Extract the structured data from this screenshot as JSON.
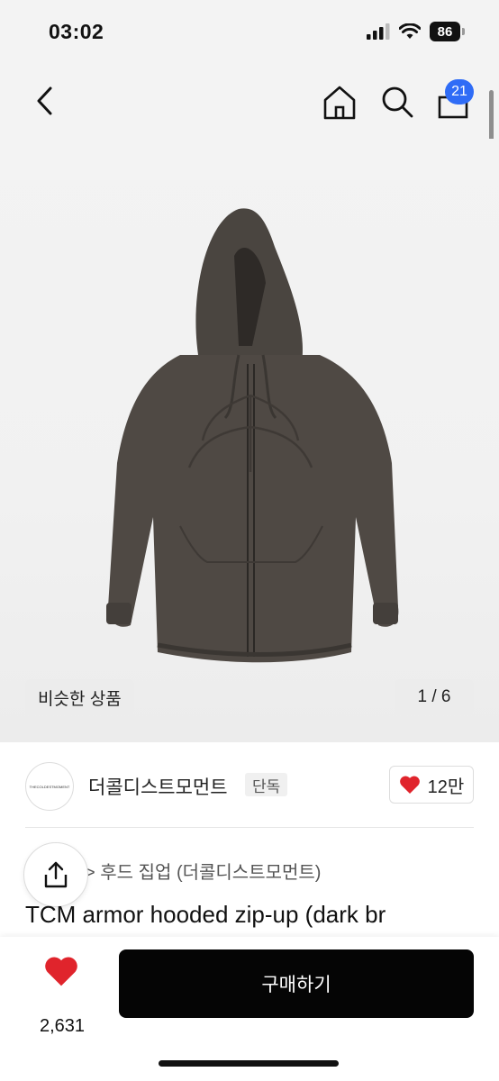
{
  "status_bar": {
    "time": "03:02",
    "battery": "86",
    "icons": [
      "signal-icon",
      "wifi-icon",
      "battery-icon"
    ]
  },
  "nav": {
    "icons": [
      "back-icon",
      "home-icon",
      "search-icon",
      "cart-icon"
    ],
    "cart_badge": "21"
  },
  "gallery": {
    "similar_label": "비슷한 상품",
    "page_counter": "1 / 6"
  },
  "brand": {
    "name": "더콜디스트모먼트",
    "tag": "단독",
    "logo_text": "THECOLDESTMOMENT",
    "likes": "12만"
  },
  "product": {
    "category": "> 후드 집업 (더콜디스트모먼트)",
    "title": "TCM armor hooded zip-up (dark br"
  },
  "bottom_bar": {
    "wish_count": "2,631",
    "buy_label": "구매하기"
  },
  "colors": {
    "accent_blue": "#2f6cf6",
    "heart_red": "#e0242c",
    "buy_button": "#050505",
    "hoodie": "#4a4540"
  }
}
